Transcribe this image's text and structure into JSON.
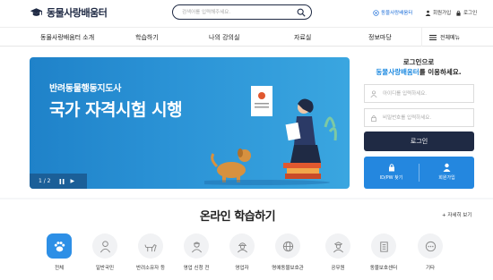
{
  "header": {
    "logo_text": "동물사랑배움터",
    "search_placeholder": "검색어를 입력해주세요.",
    "util": {
      "portal": "동물사랑배움터",
      "signup": "회원가입",
      "login": "로그인"
    }
  },
  "gnb": {
    "items": [
      "동물사랑배움터 소개",
      "학습하기",
      "나의 강의실",
      "자료실",
      "정보마당"
    ],
    "all_menu": "전체메뉴"
  },
  "banner": {
    "subtitle": "반려동물행동지도사",
    "title": "국가 자격시험 시행",
    "counter": "1 / 2",
    "next": "▶"
  },
  "login": {
    "title_line1": "로그인으로",
    "title_accent": "동물사랑배움터",
    "title_suffix": "를 이용하세요.",
    "id_placeholder": "아이디를 입력하세요.",
    "pw_placeholder": "비밀번호를 입력하세요.",
    "button": "로그인",
    "find": "ID/PW 찾기",
    "join": "회원가입"
  },
  "online": {
    "title": "온라인 학습하기",
    "more": "+ 자세히 보기",
    "categories": [
      {
        "label": "전체",
        "icon": "paw-icon"
      },
      {
        "label": "일반국민",
        "icon": "person-icon"
      },
      {
        "label": "반려소유자 등",
        "icon": "dog-icon"
      },
      {
        "label": "영업 신청 전",
        "icon": "worker-icon"
      },
      {
        "label": "영업자",
        "icon": "helmet-icon"
      },
      {
        "label": "명예동물보호관",
        "icon": "globe-icon"
      },
      {
        "label": "공무원",
        "icon": "officer-icon"
      },
      {
        "label": "동물보호센터",
        "icon": "building-icon"
      },
      {
        "label": "기타",
        "icon": "more-icon"
      }
    ]
  },
  "colors": {
    "navy": "#1f2a44",
    "blue": "#1e8ae0",
    "banner": "#2b93d6"
  }
}
